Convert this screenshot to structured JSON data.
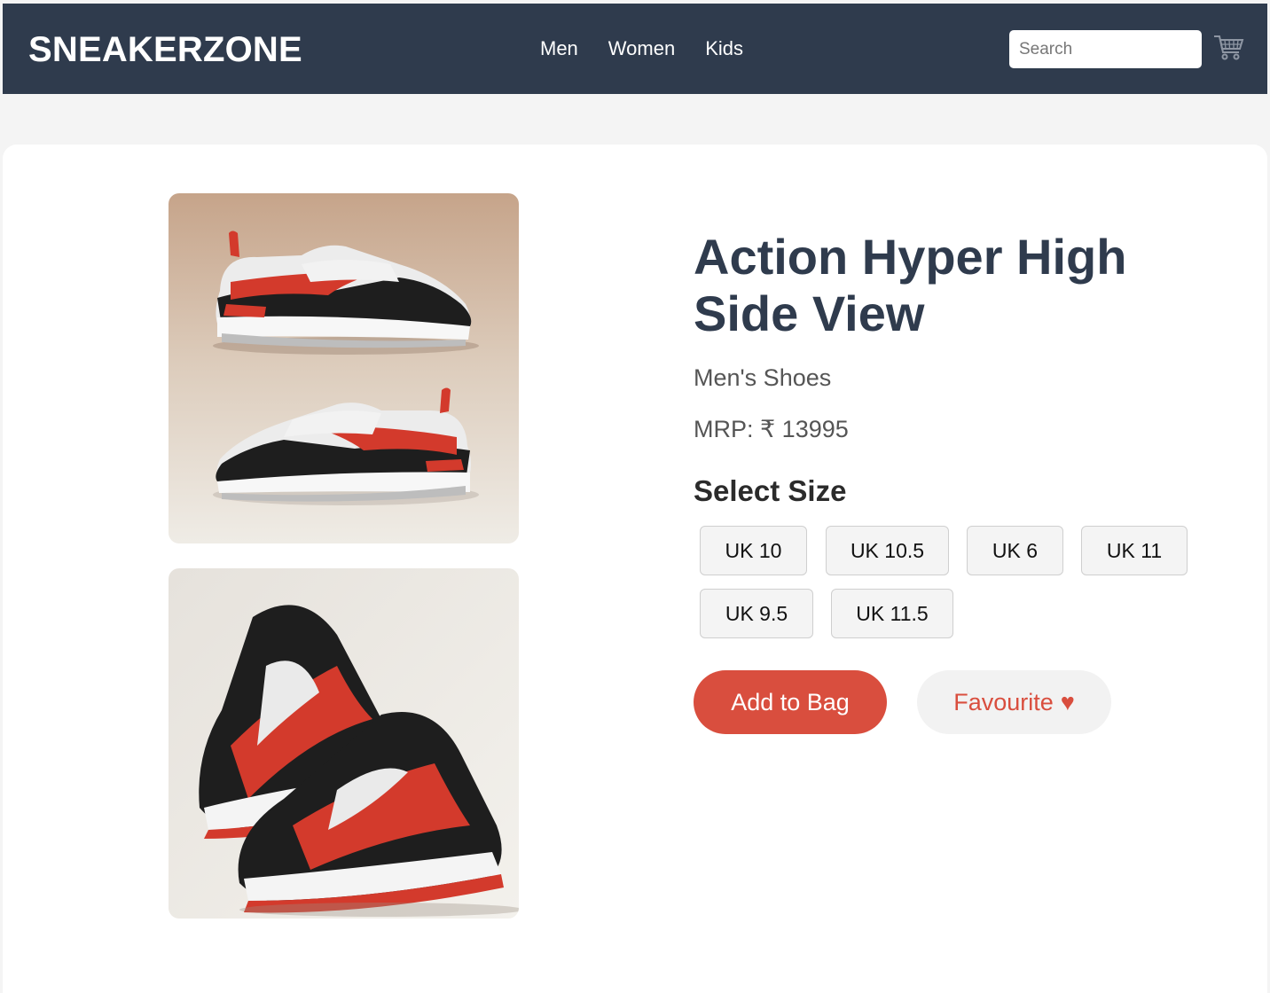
{
  "header": {
    "brand": "SNEAKERZONE",
    "nav": [
      "Men",
      "Women",
      "Kids"
    ],
    "search_placeholder": "Search",
    "cart_icon": "cart-icon"
  },
  "product": {
    "title": "Action Hyper High Side View",
    "category": "Men's Shoes",
    "price": "MRP: ₹ 13995",
    "size_heading": "Select Size",
    "sizes": [
      "UK 10",
      "UK 10.5",
      "UK 6",
      "UK 11",
      "UK 9.5",
      "UK 11.5"
    ],
    "add_to_bag": "Add to Bag",
    "favourite": "Favourite",
    "favourite_icon": "♥"
  },
  "colors": {
    "header_bg": "#2f3b4d",
    "accent": "#d94e3e",
    "title": "#2f3b4d"
  }
}
